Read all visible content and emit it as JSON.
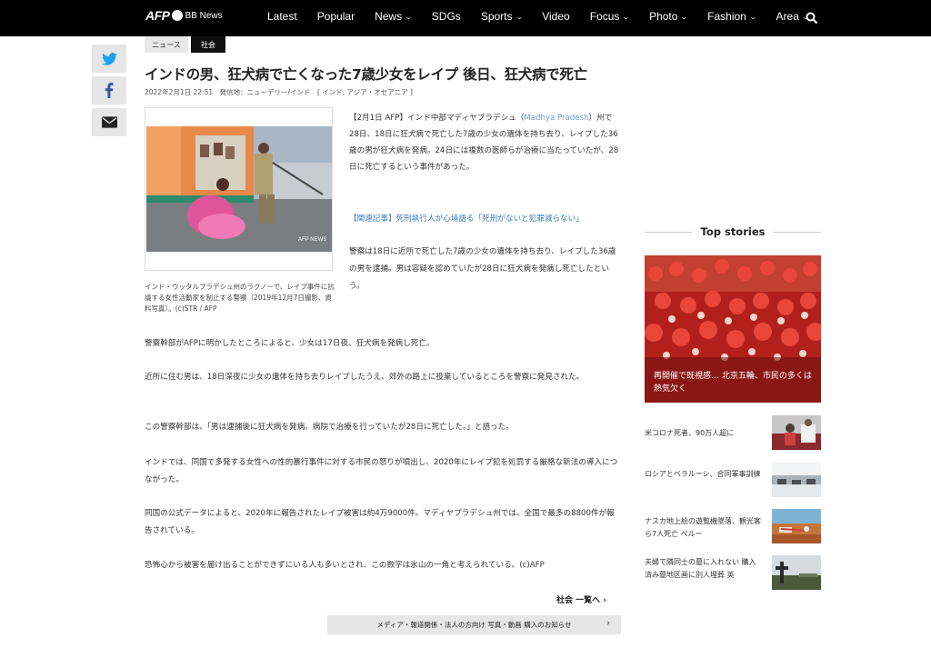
{
  "header": {
    "logo_main": "AFP",
    "logo_sub": "BB News",
    "nav": [
      {
        "label": "Latest",
        "dropdown": false
      },
      {
        "label": "Popular",
        "dropdown": false
      },
      {
        "label": "News",
        "dropdown": true
      },
      {
        "label": "SDGs",
        "dropdown": false
      },
      {
        "label": "Sports",
        "dropdown": true
      },
      {
        "label": "Video",
        "dropdown": false
      },
      {
        "label": "Focus",
        "dropdown": true
      },
      {
        "label": "Photo",
        "dropdown": true
      },
      {
        "label": "Fashion",
        "dropdown": true
      },
      {
        "label": "Area",
        "dropdown": true
      }
    ],
    "search_icon": "search-icon"
  },
  "share": [
    {
      "icon": "twitter-icon",
      "color": "#1da1f2"
    },
    {
      "icon": "facebook-icon",
      "color": "#3b5998"
    },
    {
      "icon": "email-icon",
      "color": "#222222"
    }
  ],
  "article": {
    "tags": [
      "ニュース",
      "社会"
    ],
    "title": "インドの男、狂犬病で亡くなった7歳少女をレイプ 後日、狂犬病で死亡",
    "date": "2022年2月1日 22:51",
    "dateline": "発信地：ニューデリー/インド",
    "regions": "[ インド, アジア・オセアニア ]",
    "photo_watermark": "AFP NEWS",
    "caption": "インド・ウッタルプラデシュ州のラクノーで、レイプ事件に抗議する女性活動家を制止する警察（2019年12月7日撮影、資料写真）。(c)STR / AFP",
    "lead_1": "【2月1日 AFP】インド中部マディヤプラデシュ（",
    "lead_en": "Madhya Pradesh",
    "lead_2": "）州で28日、18日に狂犬病で死亡した7歳の少女の遺体を持ち去り、レイプした36歳の男が狂犬病を発病。24日には複数の医師らが治療に当たっていたが、28日に死亡するという事件があった。",
    "related": "【関連記事】死刑執行人が心境語る「死刑がないと犯罪減らない」",
    "paragraphs": [
      "警察は18日に近所で死亡した7歳の少女の遺体を持ち去り、レイプした36歳の男を逮捕。男は容疑を認めていたが28日に狂犬病を発病し死亡したという。",
      "警察幹部がAFPに明かしたところによると、少女は17日夜、狂犬病を発病し死亡。",
      "近所に住む男は、18日深夜に少女の遺体を持ち去りレイプしたうえ、郊外の路上に投棄しているところを警察に発見された。",
      "この警察幹部は、「男は逮捕後に狂犬病を発病。病院で治療を行っていたが28日に死亡した。」と語った。",
      "インドでは、同国で多発する女性への性的暴行事件に対する市民の怒りが噴出し、2020年にレイプ犯を処罰する厳格な新法の導入につながった。",
      "同国の公式データによると、2020年に報告されたレイプ被害は約4万9000件。マディヤプラデシュ州では、全国で最多の8800件が報告されている。",
      "恐怖心から被害を届け出ることができずにいる人も多いとされ、この数字は氷山の一角と考えられている。(c)AFP"
    ],
    "more_link": "社会 一覧へ",
    "notice": "メディア・報道関係・法人の方向け 写真・動画 購入のお知らせ"
  },
  "sidebar": {
    "top_stories_title": "Top stories",
    "feature_caption": "再開催で既視感… 北京五輪、市民の多くは熱気欠く",
    "stories": [
      {
        "text": "米コロナ死者、90万人超に"
      },
      {
        "text": "ロシアとベラルーシ、合同軍事訓練"
      },
      {
        "text": "ナスカ地上絵の遊覧機墜落、観光客ら7人死亡 ペルー"
      },
      {
        "text": "夫婦で隣同士の墓に入れない 購入済み墓地区画に別人埋葬 英"
      }
    ]
  }
}
